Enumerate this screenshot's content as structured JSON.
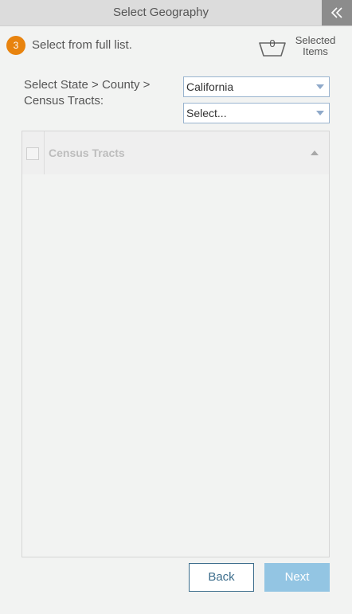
{
  "header": {
    "title": "Select Geography",
    "collapse_icon": "double-chevron-left-icon"
  },
  "step": {
    "number": "3",
    "label": "Select from full list.",
    "badge_color": "#e8830e"
  },
  "selected": {
    "count": "0",
    "label_line1": "Selected",
    "label_line2": "Items",
    "icon": "basket-icon"
  },
  "prompt": {
    "line1": "Select State > County >",
    "line2": "Census Tracts:"
  },
  "state_select": {
    "value": "California"
  },
  "county_select": {
    "value": "Select..."
  },
  "grid": {
    "column_header": "Census Tracts",
    "sort_direction": "ascending",
    "rows": []
  },
  "buttons": {
    "back": "Back",
    "next": "Next"
  },
  "colors": {
    "accent": "#3c6d8c",
    "next_disabled": "#93c5e3",
    "header_bg": "#dcdcdc"
  }
}
